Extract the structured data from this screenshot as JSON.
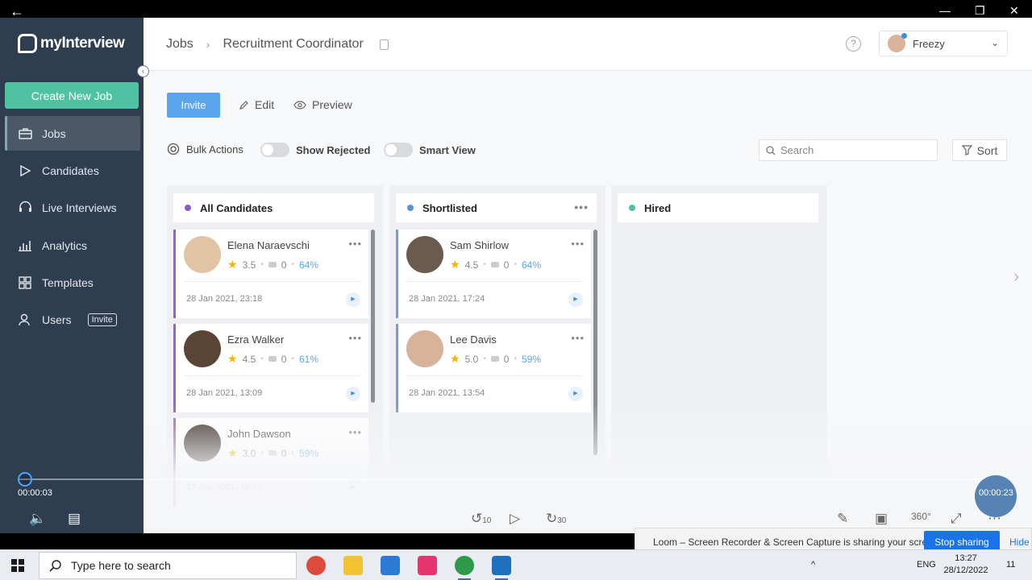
{
  "app": {
    "logo_text": "myInterview",
    "create_button": "Create New Job",
    "nav": [
      {
        "label": "Jobs",
        "icon": "briefcase-icon",
        "active": true
      },
      {
        "label": "Candidates",
        "icon": "play-icon"
      },
      {
        "label": "Live Interviews",
        "icon": "headset-icon"
      },
      {
        "label": "Analytics",
        "icon": "bar-chart-icon"
      },
      {
        "label": "Templates",
        "icon": "grid-icon"
      },
      {
        "label": "Users",
        "icon": "users-icon",
        "badge": "Invite"
      }
    ]
  },
  "header": {
    "breadcrumb_root": "Jobs",
    "breadcrumb_separator": "›",
    "job_title": "Recruitment Coordinator",
    "help_glyph": "?",
    "user_name": "Freezy"
  },
  "toolbar": {
    "invite": "Invite",
    "edit": "Edit",
    "preview": "Preview",
    "bulk_actions": "Bulk Actions",
    "show_rejected": "Show Rejected",
    "smart_view": "Smart View",
    "search_placeholder": "Search",
    "sort": "Sort"
  },
  "columns": [
    {
      "title": "All Candidates",
      "dot_color": "#8b5cc8",
      "cards": [
        {
          "name": "Elena Naraevschi",
          "rating": "3.5",
          "comments": "0",
          "score": "64%",
          "date": "28 Jan 2021, 23:18"
        },
        {
          "name": "Ezra Walker",
          "rating": "4.5",
          "comments": "0",
          "score": "61%",
          "date": "28 Jan 2021, 13:09"
        },
        {
          "name": "John Dawson",
          "rating": "3.0",
          "comments": "0",
          "score": "59%",
          "date": "27 Jan 2021, 18:37"
        }
      ]
    },
    {
      "title": "Shortlisted",
      "dot_color": "#5a8fe0",
      "cards": [
        {
          "name": "Sam Shirlow",
          "rating": "4.5",
          "comments": "0",
          "score": "64%",
          "date": "28 Jan 2021, 17:24"
        },
        {
          "name": "Lee Davis",
          "rating": "5.0",
          "comments": "0",
          "score": "59%",
          "date": "28 Jan 2021, 13:54"
        }
      ]
    },
    {
      "title": "Hired",
      "dot_color": "#4fc3a1",
      "cards": []
    }
  ],
  "player": {
    "current_time": "00:00:03",
    "end_time": "00:00:23",
    "rewind": "10",
    "forward": "30"
  },
  "loom": {
    "message": "Loom – Screen Recorder & Screen Capture is sharing your screen.",
    "stop": "Stop sharing",
    "hide": "Hide"
  },
  "taskbar": {
    "search_placeholder": "Type here to search",
    "language": "ENG",
    "time": "13:27",
    "date": "28/12/2022",
    "notifications": "11"
  }
}
